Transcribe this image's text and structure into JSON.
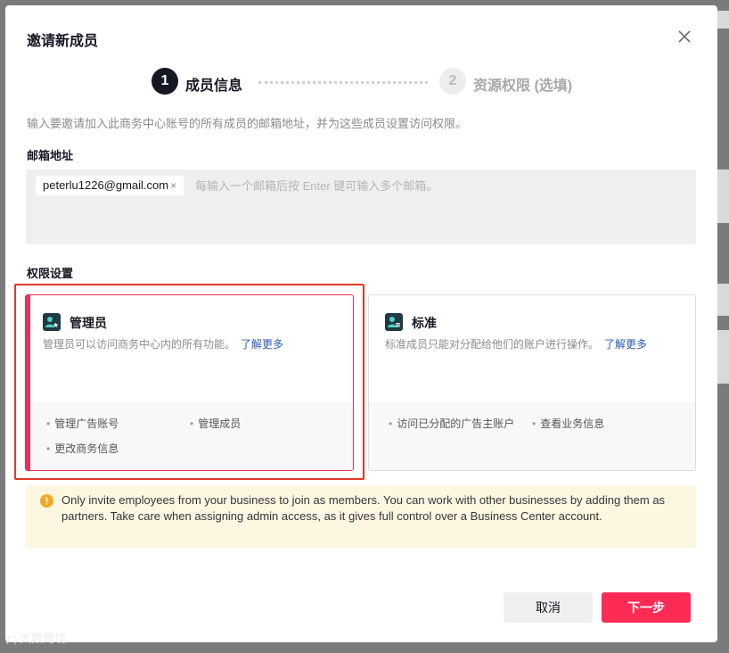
{
  "modal": {
    "title": "邀请新成员",
    "close_icon": "close-icon"
  },
  "steps": [
    {
      "number": "1",
      "label": "成员信息",
      "active": true
    },
    {
      "number": "2",
      "label": "资源权限 (选填)",
      "active": false
    }
  ],
  "description": "输入要邀请加入此商务中心账号的所有成员的邮箱地址，并为这些成员设置访问权限。",
  "email": {
    "label": "邮箱地址",
    "tags": [
      "peterlu1226@gmail.com"
    ],
    "remove_symbol": "×",
    "placeholder": "每输入一个邮箱后按 Enter 键可输入多个邮箱。"
  },
  "permissions": {
    "label": "权限设置",
    "admin": {
      "title": "管理员",
      "description": "管理员可以访问商务中心内的所有功能。",
      "learn_more": "了解更多",
      "features": [
        "管理广告账号",
        "管理成员",
        "更改商务信息"
      ],
      "selected": true
    },
    "standard": {
      "title": "标准",
      "description": "标准成员只能对分配给他们的账户进行操作。",
      "learn_more": "了解更多",
      "features": [
        "访问已分配的广告主账户",
        "查看业务信息"
      ],
      "selected": false
    }
  },
  "notice": {
    "icon": "warning-icon",
    "text": "Only invite employees from your business to join as members. You can work with other businesses by adding them as partners. Take care when assigning admin access, as it gives full control over a Business Center account."
  },
  "buttons": {
    "cancel": "取消",
    "next": "下一步"
  },
  "watermark": {
    "logo": "(C)",
    "text": "大数跨境"
  },
  "colors": {
    "accent": "#fe2c55",
    "selected_border": "#e5325a",
    "link": "#2b5ab4",
    "notice_bg": "#fdf6e0",
    "warning": "#f5a623"
  }
}
